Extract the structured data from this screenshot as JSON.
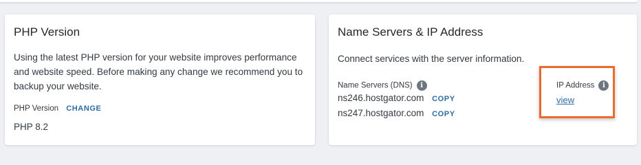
{
  "php_card": {
    "title": "PHP Version",
    "description": "Using the latest PHP version for your website improves performance and website speed. Before making any change we recommend you to backup your website.",
    "version_label": "PHP Version",
    "change_label": "CHANGE",
    "version_value": "PHP 8.2"
  },
  "ns_card": {
    "title": "Name Servers & IP Address",
    "description": "Connect services with the server information.",
    "ns_label": "Name Servers (DNS)",
    "name_servers": [
      {
        "host": "ns246.hostgator.com",
        "copy_label": "COPY"
      },
      {
        "host": "ns247.hostgator.com",
        "copy_label": "COPY"
      }
    ],
    "ip_label": "IP Address",
    "ip_view_label": "view",
    "info_icon_glyph": "i"
  },
  "colors": {
    "link": "#2e6da4",
    "highlight_border": "#ec6a2d",
    "info_icon": "#6e767d"
  }
}
